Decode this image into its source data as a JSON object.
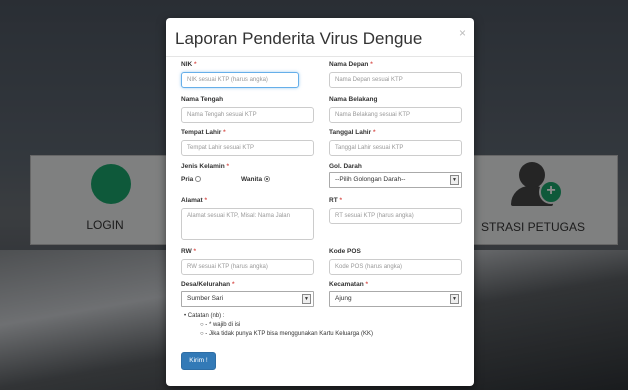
{
  "background": {
    "login_label": "LOGIN",
    "register_label": "STRASI PETUGAS"
  },
  "modal": {
    "title": "Laporan Penderita Virus Dengue",
    "close": "×"
  },
  "form": {
    "nik": {
      "label": "NIK",
      "placeholder": "NIK sesuai KTP (harus angka)"
    },
    "nama_depan": {
      "label": "Nama Depan",
      "placeholder": "Nama Depan sesuai KTP"
    },
    "nama_tengah": {
      "label": "Nama Tengah",
      "placeholder": "Nama Tengah sesuai KTP"
    },
    "nama_belakang": {
      "label": "Nama Belakang",
      "placeholder": "Nama Belakang sesuai KTP"
    },
    "tempat_lahir": {
      "label": "Tempat Lahir",
      "placeholder": "Tempat Lahir sesuai KTP"
    },
    "tanggal_lahir": {
      "label": "Tanggal Lahir",
      "placeholder": "Tanggal Lahir sesuai KTP"
    },
    "jenis_kelamin": {
      "label": "Jenis Kelamin",
      "pria": "Pria",
      "wanita": "Wanita",
      "selected": "Wanita"
    },
    "gol_darah": {
      "label": "Gol. Darah",
      "value": "--Pilih Golongan Darah--"
    },
    "alamat": {
      "label": "Alamat",
      "placeholder": "Alamat sesuai KTP, Misal: Nama Jalan"
    },
    "rt": {
      "label": "RT",
      "placeholder": "RT sesuai KTP (harus angka)"
    },
    "rw": {
      "label": "RW",
      "placeholder": "RW sesuai KTP (harus angka)"
    },
    "kode_pos": {
      "label": "Kode POS",
      "placeholder": "Kode POS (harus angka)"
    },
    "desa": {
      "label": "Desa/Kelurahan",
      "value": "Sumber Sari"
    },
    "kecamatan": {
      "label": "Kecamatan",
      "value": "Ajung"
    },
    "required_mark": "*"
  },
  "notes": {
    "title": "• Catatan (nb) :",
    "item1": "○ - * wajib di isi",
    "item2": "○ - Jika tidak punya KTP bisa menggunakan Kartu Keluarga (KK)"
  },
  "submit_label": "Kirim !"
}
